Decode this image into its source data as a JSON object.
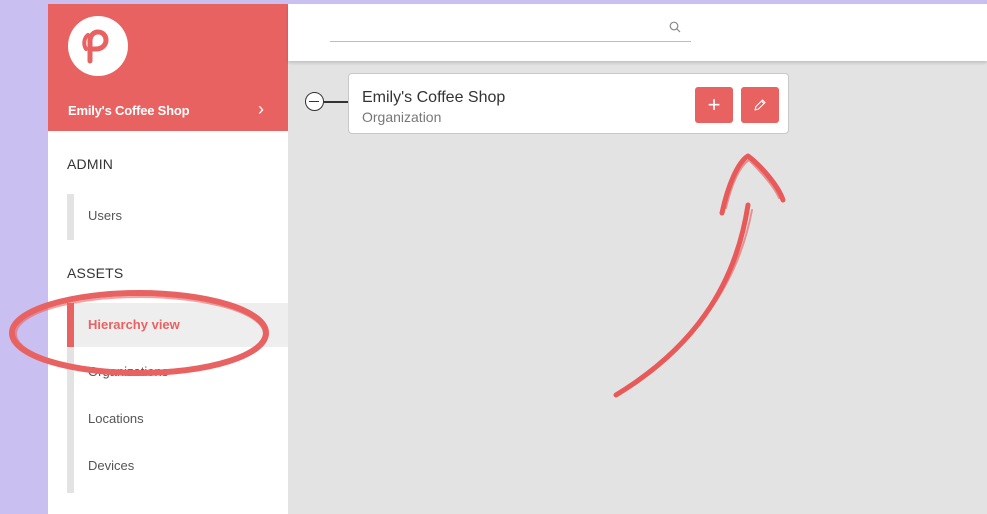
{
  "brand": {
    "name": "Emily's Coffee Shop",
    "chevron": "›",
    "logo_icon": "heart-logo-icon"
  },
  "search": {
    "placeholder": "",
    "icon": "search-icon"
  },
  "sidebar": {
    "admin_title": "ADMIN",
    "admin_items": [
      {
        "label": "Users"
      }
    ],
    "assets_title": "ASSETS",
    "assets_items": [
      {
        "label": "Hierarchy view",
        "active": true
      },
      {
        "label": "Organizations"
      },
      {
        "label": "Locations"
      },
      {
        "label": "Devices"
      }
    ]
  },
  "tree": {
    "node": {
      "title": "Emily's Coffee Shop",
      "type": "Organization",
      "add_label": "+"
    }
  },
  "colors": {
    "accent": "#e96262",
    "background": "#e3e3e3",
    "page": "#c9bff0"
  }
}
